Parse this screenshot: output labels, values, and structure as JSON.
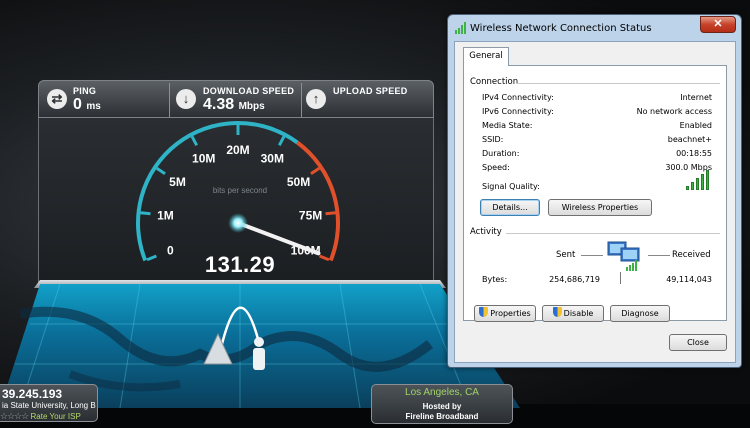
{
  "speedtest": {
    "ping": {
      "label": "PING",
      "value": "0",
      "unit": "ms"
    },
    "download": {
      "label": "DOWNLOAD SPEED",
      "value": "4.38",
      "unit": "Mbps"
    },
    "upload": {
      "label": "UPLOAD SPEED"
    },
    "gauge": {
      "ticks": [
        "0",
        "1M",
        "5M",
        "10M",
        "20M",
        "30M",
        "50M",
        "75M",
        "100M"
      ],
      "units_caption": "bits per second",
      "reading": "131.29",
      "max_value": 100,
      "needle_value": 95
    },
    "isp": {
      "ip": "39.245.193",
      "name": "ia State University, Long Be",
      "stars": "☆☆☆☆",
      "rate_label": "Rate Your ISP"
    },
    "host": {
      "city": "Los Angeles, CA",
      "hosted_by": "Hosted by",
      "provider": "Fireline Broadband"
    },
    "colors": {
      "accent": "#2fb3c6",
      "warn": "#e0502a",
      "graph": "#7fd27a"
    }
  },
  "dialog": {
    "title": "Wireless Network Connection Status",
    "close_glyph": "✕",
    "tab": "General",
    "connection": {
      "heading": "Connection",
      "rows": [
        {
          "key": "IPv4 Connectivity:",
          "value": "Internet"
        },
        {
          "key": "IPv6 Connectivity:",
          "value": "No network access"
        },
        {
          "key": "Media State:",
          "value": "Enabled"
        },
        {
          "key": "SSID:",
          "value": "beachnet+"
        },
        {
          "key": "Duration:",
          "value": "00:18:55"
        },
        {
          "key": "Speed:",
          "value": "300.0 Mbps"
        }
      ],
      "signal_label": "Signal Quality:",
      "signal_bars": 5,
      "details_button": "Details...",
      "wireless_button": "Wireless Properties"
    },
    "activity": {
      "heading": "Activity",
      "sent_label": "Sent",
      "received_label": "Received",
      "bytes_label": "Bytes:",
      "sent_bytes": "254,686,719",
      "received_bytes": "49,114,043"
    },
    "buttons": {
      "properties": "Properties",
      "disable": "Disable",
      "diagnose": "Diagnose",
      "close": "Close"
    }
  }
}
